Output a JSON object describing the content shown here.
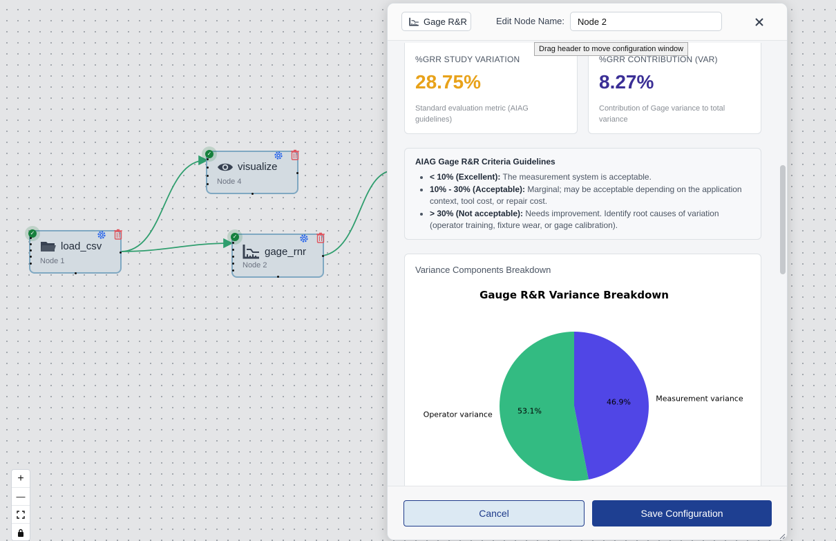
{
  "canvas": {
    "nodes": [
      {
        "id": "load_csv",
        "title": "load_csv",
        "subtitle": "Node 1",
        "icon": "folder-icon"
      },
      {
        "id": "visualize",
        "title": "visualize",
        "subtitle": "Node 4",
        "icon": "eye-icon"
      },
      {
        "id": "gage_rnr",
        "title": "gage_rnr",
        "subtitle": "Node 2",
        "icon": "gage-icon"
      }
    ],
    "status_glyph": "✓",
    "edge_color": "#2f9e6e"
  },
  "zoom_controls": {
    "zoom_in": "+",
    "zoom_out": "—"
  },
  "panel": {
    "type_button": "Gage R&R",
    "name_label": "Edit Node Name:",
    "name_value": "Node 2",
    "tooltip": "Drag header to move configuration window",
    "metrics": [
      {
        "title": "%GRR STUDY VARIATION",
        "value": "28.75%",
        "description": "Standard evaluation metric (AIAG guidelines)",
        "color": "#e8a21a"
      },
      {
        "title": "%GRR CONTRIBUTION (VAR)",
        "value": "8.27%",
        "description": "Contribution of Gage variance to total variance",
        "color": "#3b2f96"
      }
    ],
    "guidelines": {
      "title": "AIAG Gage R&R Criteria Guidelines",
      "items": [
        {
          "label": "< 10% (Excellent):",
          "text": " The measurement system is acceptable."
        },
        {
          "label": "10% - 30% (Acceptable):",
          "text": " Marginal; may be acceptable depending on the application context, tool cost, or repair cost."
        },
        {
          "label": "> 30% (Not acceptable):",
          "text": " Needs improvement. Identify root causes of variation (operator training, fixture wear, or gage calibration)."
        }
      ]
    },
    "variance_section_title": "Variance Components Breakdown",
    "cancel_label": "Cancel",
    "save_label": "Save Configuration"
  },
  "chart_data": {
    "type": "pie",
    "title": "Gauge R&R Variance Breakdown",
    "labels": [
      "Measurement variance",
      "Operator variance"
    ],
    "values": [
      46.9,
      53.1
    ],
    "value_labels": [
      "46.9%",
      "53.1%"
    ],
    "colors": [
      "#5046e6",
      "#33bb82"
    ],
    "start_angle_deg": 90,
    "direction": "clockwise"
  }
}
